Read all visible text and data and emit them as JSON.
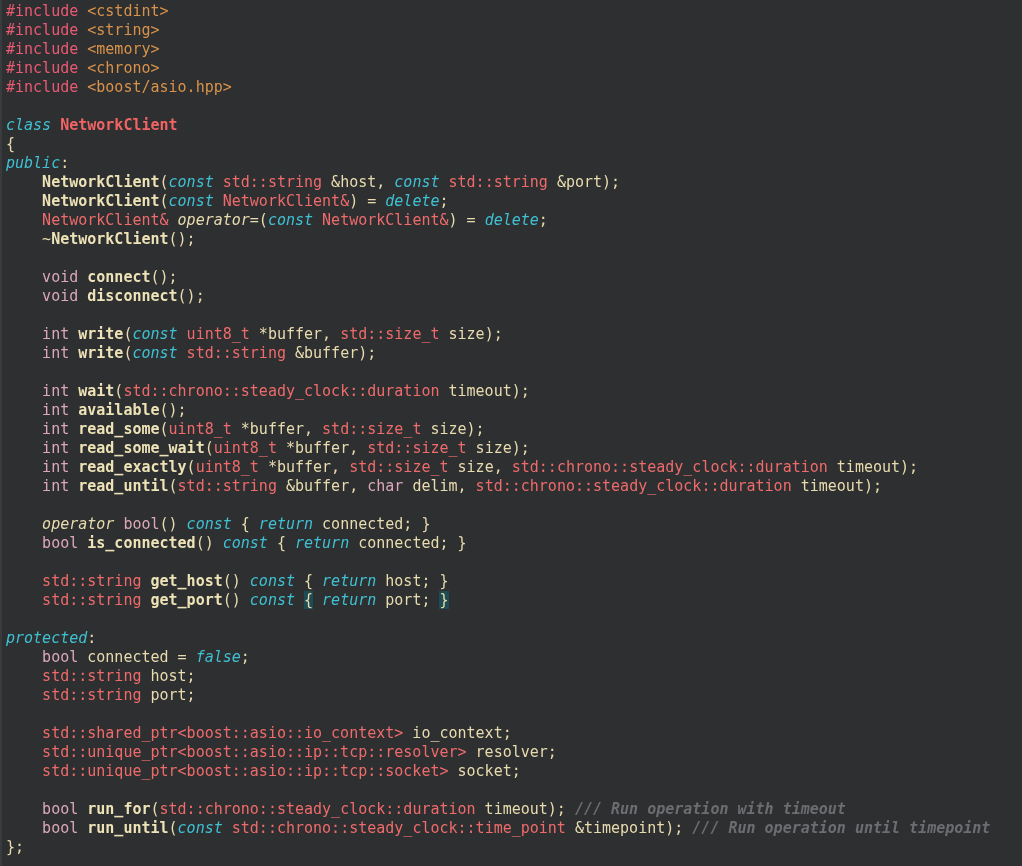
{
  "editor": {
    "blocks": [
      {
        "lines": [
          {
            "tokens": [
              {
                "kind": "preproc",
                "text": "#include "
              },
              {
                "kind": "header",
                "text": "<cstdint>"
              }
            ]
          },
          {
            "tokens": [
              {
                "kind": "preproc",
                "text": "#include "
              },
              {
                "kind": "header",
                "text": "<string>"
              }
            ]
          },
          {
            "tokens": [
              {
                "kind": "preproc",
                "text": "#include "
              },
              {
                "kind": "header",
                "text": "<memory>"
              }
            ]
          },
          {
            "tokens": [
              {
                "kind": "preproc",
                "text": "#include "
              },
              {
                "kind": "header",
                "text": "<chrono>"
              }
            ]
          },
          {
            "tokens": [
              {
                "kind": "preproc",
                "text": "#include "
              },
              {
                "kind": "header",
                "text": "<boost/asio.hpp>"
              }
            ]
          }
        ]
      },
      {
        "lines": [
          {
            "tokens": [
              {
                "kind": "keyword",
                "text": "class "
              },
              {
                "kind": "classname",
                "text": "NetworkClient"
              }
            ]
          },
          {
            "tokens": [
              {
                "kind": "plain",
                "text": "{"
              }
            ]
          },
          {
            "tokens": [
              {
                "kind": "keyword",
                "text": "public"
              },
              {
                "kind": "plain",
                "text": ":"
              }
            ]
          },
          {
            "indent": true,
            "tokens": [
              {
                "kind": "function",
                "text": "NetworkClient"
              },
              {
                "kind": "plain",
                "text": "("
              },
              {
                "kind": "keyword",
                "text": "const "
              },
              {
                "kind": "type",
                "text": "std::string"
              },
              {
                "kind": "plain",
                "text": " &host, "
              },
              {
                "kind": "keyword",
                "text": "const "
              },
              {
                "kind": "type",
                "text": "std::string"
              },
              {
                "kind": "plain",
                "text": " &port);"
              }
            ]
          },
          {
            "indent": true,
            "tokens": [
              {
                "kind": "function",
                "text": "NetworkClient"
              },
              {
                "kind": "plain",
                "text": "("
              },
              {
                "kind": "keyword",
                "text": "const "
              },
              {
                "kind": "type",
                "text": "NetworkClient&"
              },
              {
                "kind": "plain",
                "text": ") = "
              },
              {
                "kind": "keyword",
                "text": "delete"
              },
              {
                "kind": "plain",
                "text": ";"
              }
            ]
          },
          {
            "indent": true,
            "tokens": [
              {
                "kind": "type",
                "text": "NetworkClient& "
              },
              {
                "kind": "italic",
                "text": "operator"
              },
              {
                "kind": "plain",
                "text": "=("
              },
              {
                "kind": "keyword",
                "text": "const "
              },
              {
                "kind": "type",
                "text": "NetworkClient&"
              },
              {
                "kind": "plain",
                "text": ") = "
              },
              {
                "kind": "keyword",
                "text": "delete"
              },
              {
                "kind": "plain",
                "text": ";"
              }
            ]
          },
          {
            "indent": true,
            "tokens": [
              {
                "kind": "plain",
                "text": "~"
              },
              {
                "kind": "function",
                "text": "NetworkClient"
              },
              {
                "kind": "plain",
                "text": "();"
              }
            ]
          }
        ]
      },
      {
        "lines": [
          {
            "indent": true,
            "tokens": [
              {
                "kind": "builtin",
                "text": "void "
              },
              {
                "kind": "function",
                "text": "connect"
              },
              {
                "kind": "plain",
                "text": "();"
              }
            ]
          },
          {
            "indent": true,
            "tokens": [
              {
                "kind": "builtin",
                "text": "void "
              },
              {
                "kind": "function",
                "text": "disconnect"
              },
              {
                "kind": "plain",
                "text": "();"
              }
            ]
          }
        ]
      },
      {
        "lines": [
          {
            "indent": true,
            "tokens": [
              {
                "kind": "builtin",
                "text": "int "
              },
              {
                "kind": "function",
                "text": "write"
              },
              {
                "kind": "plain",
                "text": "("
              },
              {
                "kind": "keyword",
                "text": "const "
              },
              {
                "kind": "type",
                "text": "uint8_t"
              },
              {
                "kind": "plain",
                "text": " *buffer, "
              },
              {
                "kind": "type",
                "text": "std::size_t"
              },
              {
                "kind": "plain",
                "text": " size);"
              }
            ]
          },
          {
            "indent": true,
            "tokens": [
              {
                "kind": "builtin",
                "text": "int "
              },
              {
                "kind": "function",
                "text": "write"
              },
              {
                "kind": "plain",
                "text": "("
              },
              {
                "kind": "keyword",
                "text": "const "
              },
              {
                "kind": "type",
                "text": "std::string"
              },
              {
                "kind": "plain",
                "text": " &buffer);"
              }
            ]
          }
        ]
      },
      {
        "lines": [
          {
            "indent": true,
            "tokens": [
              {
                "kind": "builtin",
                "text": "int "
              },
              {
                "kind": "function",
                "text": "wait"
              },
              {
                "kind": "plain",
                "text": "("
              },
              {
                "kind": "type",
                "text": "std::chrono::steady_clock::duration"
              },
              {
                "kind": "plain",
                "text": " timeout);"
              }
            ]
          },
          {
            "indent": true,
            "tokens": [
              {
                "kind": "builtin",
                "text": "int "
              },
              {
                "kind": "function",
                "text": "available"
              },
              {
                "kind": "plain",
                "text": "();"
              }
            ]
          },
          {
            "indent": true,
            "tokens": [
              {
                "kind": "builtin",
                "text": "int "
              },
              {
                "kind": "function",
                "text": "read_some"
              },
              {
                "kind": "plain",
                "text": "("
              },
              {
                "kind": "type",
                "text": "uint8_t"
              },
              {
                "kind": "plain",
                "text": " *buffer, "
              },
              {
                "kind": "type",
                "text": "std::size_t"
              },
              {
                "kind": "plain",
                "text": " size);"
              }
            ]
          },
          {
            "indent": true,
            "tokens": [
              {
                "kind": "builtin",
                "text": "int "
              },
              {
                "kind": "function",
                "text": "read_some_wait"
              },
              {
                "kind": "plain",
                "text": "("
              },
              {
                "kind": "type",
                "text": "uint8_t"
              },
              {
                "kind": "plain",
                "text": " *buffer, "
              },
              {
                "kind": "type",
                "text": "std::size_t"
              },
              {
                "kind": "plain",
                "text": " size);"
              }
            ]
          },
          {
            "indent": true,
            "tokens": [
              {
                "kind": "builtin",
                "text": "int "
              },
              {
                "kind": "function",
                "text": "read_exactly"
              },
              {
                "kind": "plain",
                "text": "("
              },
              {
                "kind": "type",
                "text": "uint8_t"
              },
              {
                "kind": "plain",
                "text": " *buffer, "
              },
              {
                "kind": "type",
                "text": "std::size_t"
              },
              {
                "kind": "plain",
                "text": " size, "
              },
              {
                "kind": "type",
                "text": "std::chrono::steady_clock::duration"
              },
              {
                "kind": "plain",
                "text": " timeout);"
              }
            ]
          },
          {
            "indent": true,
            "tokens": [
              {
                "kind": "builtin",
                "text": "int "
              },
              {
                "kind": "function",
                "text": "read_until"
              },
              {
                "kind": "plain",
                "text": "("
              },
              {
                "kind": "type",
                "text": "std::string"
              },
              {
                "kind": "plain",
                "text": " &buffer, "
              },
              {
                "kind": "builtin",
                "text": "char"
              },
              {
                "kind": "plain",
                "text": " delim, "
              },
              {
                "kind": "type",
                "text": "std::chrono::steady_clock::duration"
              },
              {
                "kind": "plain",
                "text": " timeout);"
              }
            ]
          }
        ]
      },
      {
        "lines": [
          {
            "indent": true,
            "tokens": [
              {
                "kind": "italic",
                "text": "operator "
              },
              {
                "kind": "builtin",
                "text": "bool"
              },
              {
                "kind": "plain",
                "text": "() "
              },
              {
                "kind": "keyword",
                "text": "const"
              },
              {
                "kind": "plain",
                "text": " { "
              },
              {
                "kind": "keyword",
                "text": "return"
              },
              {
                "kind": "plain",
                "text": " connected; }"
              }
            ]
          },
          {
            "indent": true,
            "tokens": [
              {
                "kind": "builtin",
                "text": "bool "
              },
              {
                "kind": "function",
                "text": "is_connected"
              },
              {
                "kind": "plain",
                "text": "() "
              },
              {
                "kind": "keyword",
                "text": "const"
              },
              {
                "kind": "plain",
                "text": " { "
              },
              {
                "kind": "keyword",
                "text": "return"
              },
              {
                "kind": "plain",
                "text": " connected; }"
              }
            ]
          }
        ]
      },
      {
        "lines": [
          {
            "indent": true,
            "tokens": [
              {
                "kind": "type",
                "text": "std::string "
              },
              {
                "kind": "function",
                "text": "get_host"
              },
              {
                "kind": "plain",
                "text": "() "
              },
              {
                "kind": "keyword",
                "text": "const"
              },
              {
                "kind": "plain",
                "text": " { "
              },
              {
                "kind": "keyword",
                "text": "return"
              },
              {
                "kind": "plain",
                "text": " host; }"
              }
            ]
          },
          {
            "indent": true,
            "tokens": [
              {
                "kind": "type",
                "text": "std::string "
              },
              {
                "kind": "function",
                "text": "get_port"
              },
              {
                "kind": "plain",
                "text": "() "
              },
              {
                "kind": "keyword",
                "text": "const "
              },
              {
                "kind": "bracematch",
                "text": "{"
              },
              {
                "kind": "keyword",
                "text": " return"
              },
              {
                "kind": "plain",
                "text": " port; "
              },
              {
                "kind": "bracematch",
                "text": "}"
              }
            ]
          }
        ]
      },
      {
        "lines": [
          {
            "tokens": [
              {
                "kind": "keyword",
                "text": "protected"
              },
              {
                "kind": "plain",
                "text": ":"
              }
            ]
          },
          {
            "indent": true,
            "tokens": [
              {
                "kind": "builtin",
                "text": "bool"
              },
              {
                "kind": "plain",
                "text": " connected = "
              },
              {
                "kind": "keyword",
                "text": "false"
              },
              {
                "kind": "plain",
                "text": ";"
              }
            ]
          },
          {
            "indent": true,
            "tokens": [
              {
                "kind": "type",
                "text": "std::string"
              },
              {
                "kind": "plain",
                "text": " host;"
              }
            ]
          },
          {
            "indent": true,
            "tokens": [
              {
                "kind": "type",
                "text": "std::string"
              },
              {
                "kind": "plain",
                "text": " port;"
              }
            ]
          }
        ]
      },
      {
        "lines": [
          {
            "indent": true,
            "tokens": [
              {
                "kind": "type",
                "text": "std::shared_ptr<boost::asio::io_context>"
              },
              {
                "kind": "plain",
                "text": " io_context;"
              }
            ]
          },
          {
            "indent": true,
            "tokens": [
              {
                "kind": "type",
                "text": "std::unique_ptr<boost::asio::ip::tcp::resolver>"
              },
              {
                "kind": "plain",
                "text": " resolver;"
              }
            ]
          },
          {
            "indent": true,
            "tokens": [
              {
                "kind": "type",
                "text": "std::unique_ptr<boost::asio::ip::tcp::socket>"
              },
              {
                "kind": "plain",
                "text": " socket;"
              }
            ]
          }
        ]
      },
      {
        "lines": [
          {
            "indent": true,
            "tokens": [
              {
                "kind": "builtin",
                "text": "bool "
              },
              {
                "kind": "function",
                "text": "run_for"
              },
              {
                "kind": "plain",
                "text": "("
              },
              {
                "kind": "type",
                "text": "std::chrono::steady_clock::duration"
              },
              {
                "kind": "plain",
                "text": " timeout); "
              },
              {
                "kind": "comment",
                "text": "/// Run operation with timeout"
              }
            ]
          },
          {
            "indent": true,
            "tokens": [
              {
                "kind": "builtin",
                "text": "bool "
              },
              {
                "kind": "function",
                "text": "run_until"
              },
              {
                "kind": "plain",
                "text": "("
              },
              {
                "kind": "keyword",
                "text": "const "
              },
              {
                "kind": "type",
                "text": "std::chrono::steady_clock::time_point"
              },
              {
                "kind": "plain",
                "text": " &timepoint); "
              },
              {
                "kind": "comment",
                "text": "/// Run operation until timepoint"
              }
            ]
          },
          {
            "tokens": [
              {
                "kind": "plain",
                "text": "};"
              }
            ]
          }
        ]
      }
    ]
  }
}
